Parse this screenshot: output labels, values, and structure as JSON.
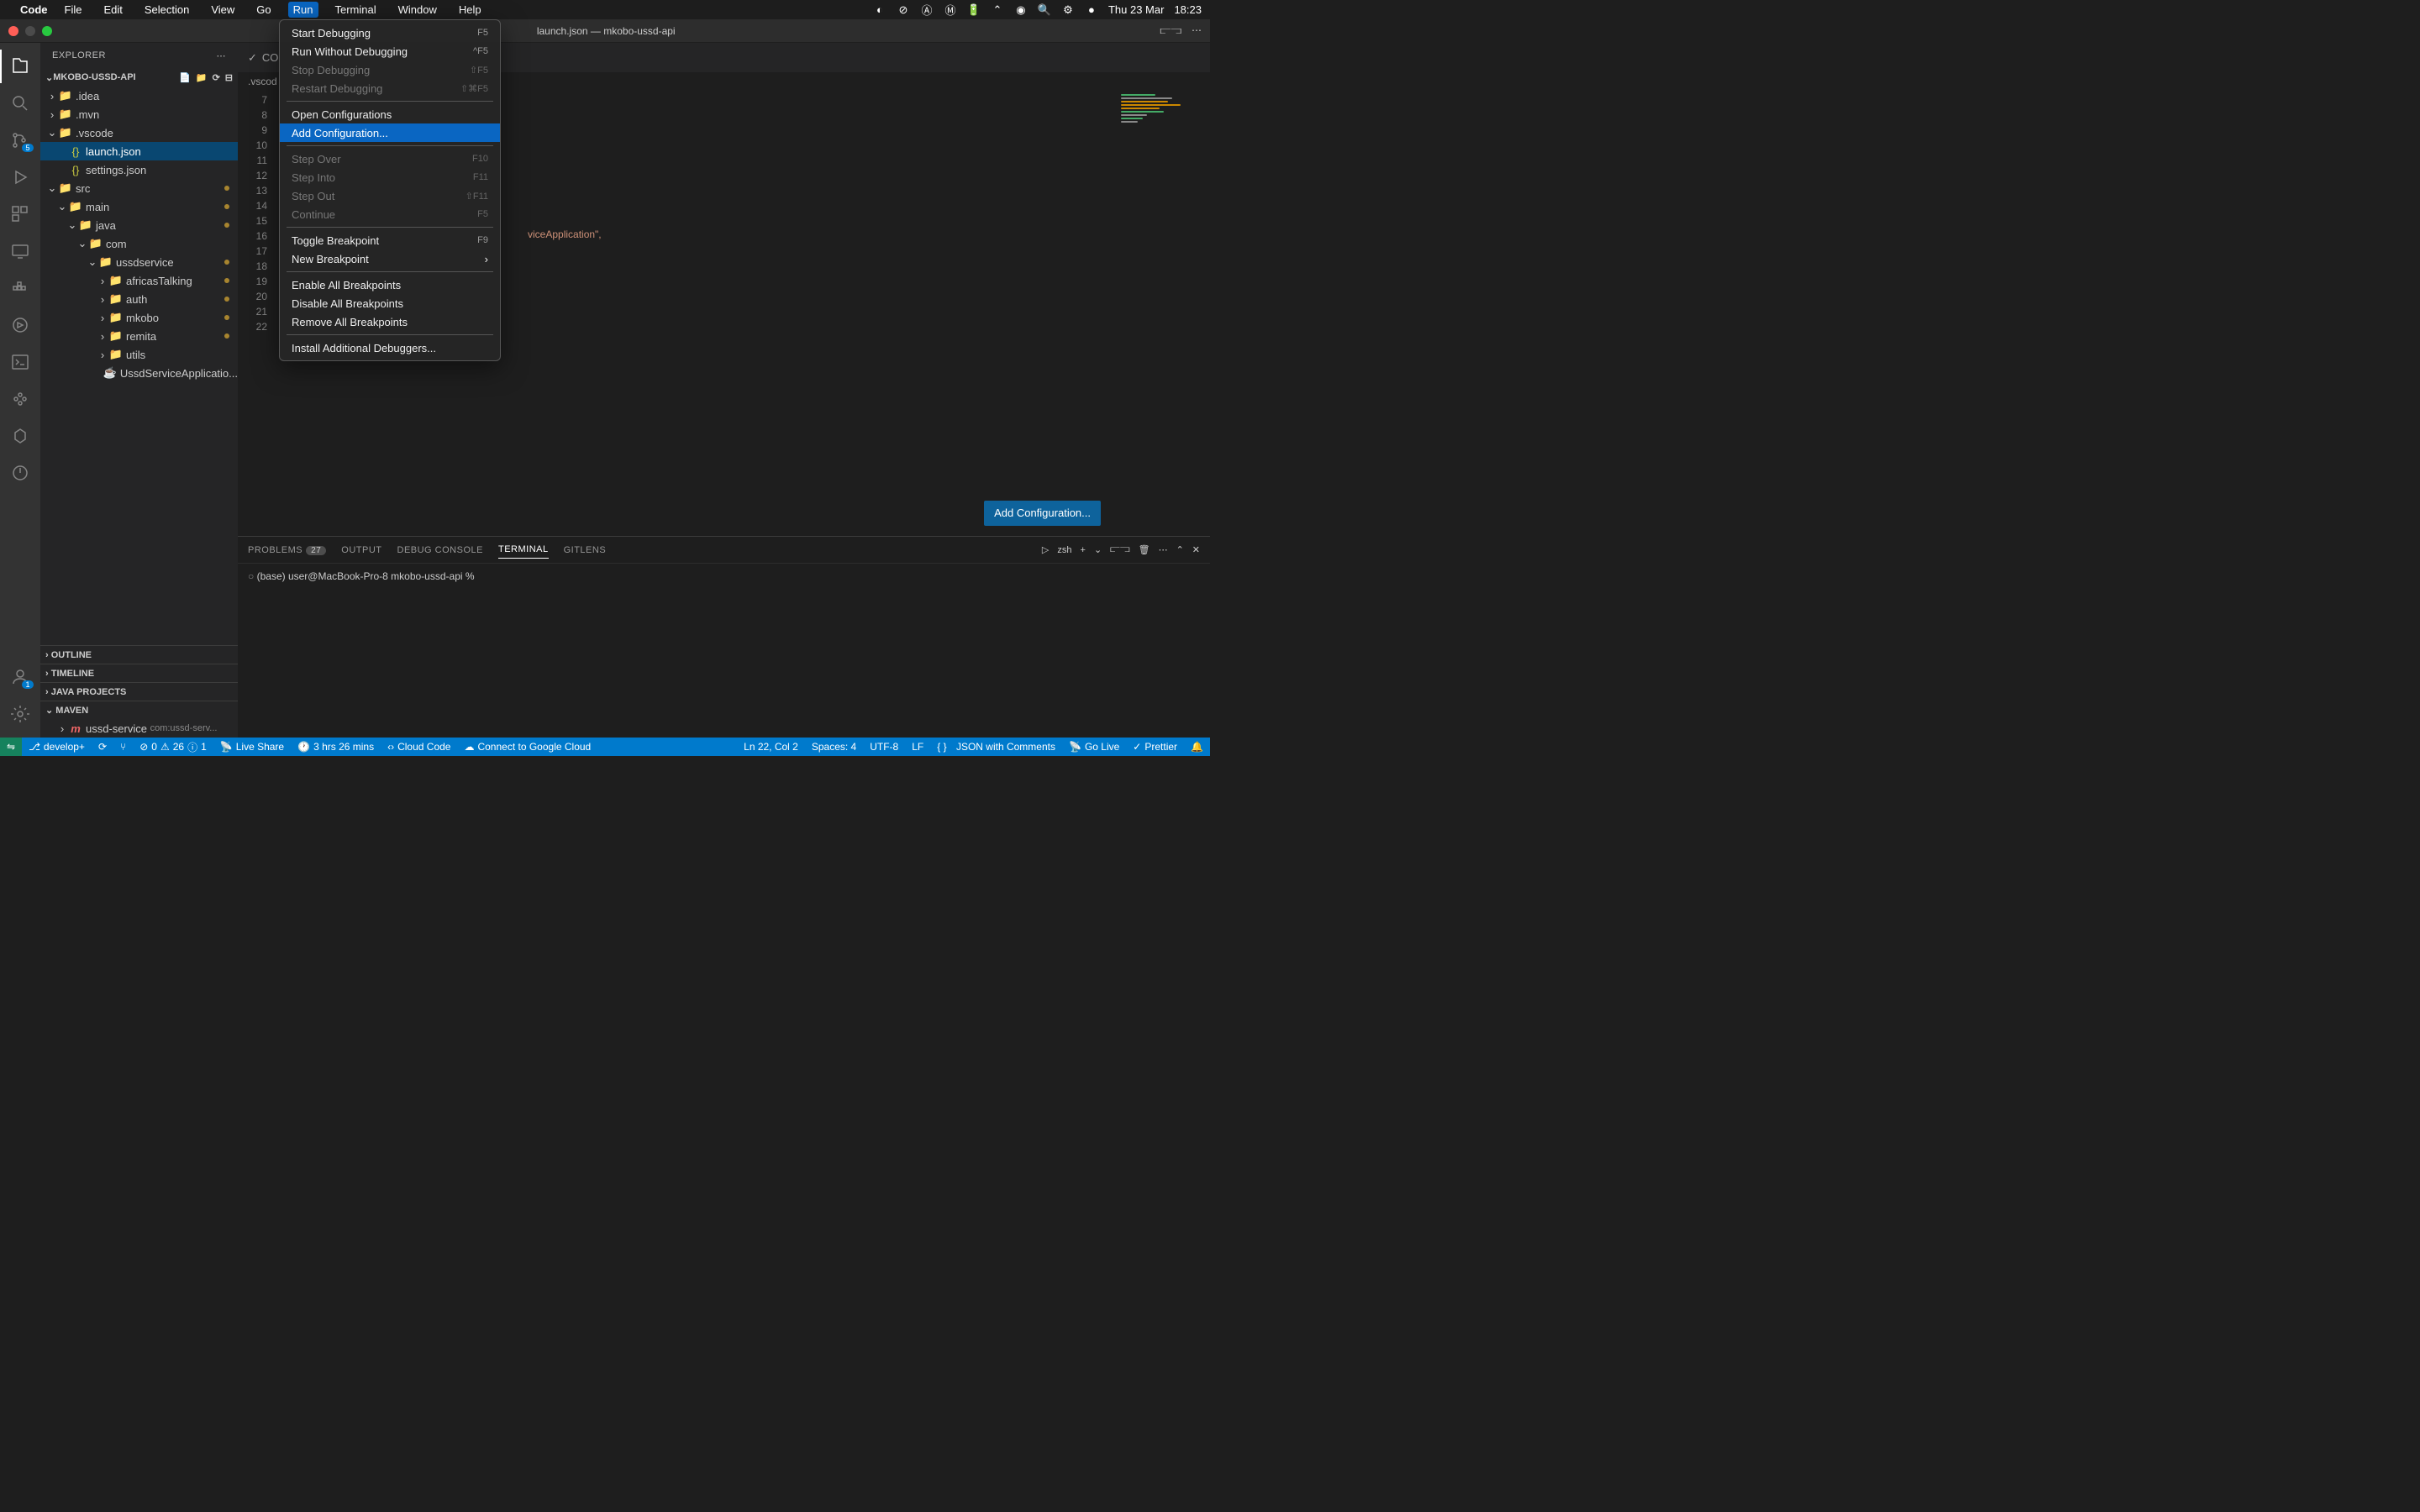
{
  "menubar": {
    "app": "Code",
    "items": [
      "File",
      "Edit",
      "Selection",
      "View",
      "Go",
      "Run",
      "Terminal",
      "Window",
      "Help"
    ],
    "active_index": 5,
    "date": "Thu 23 Mar",
    "time": "18:23"
  },
  "titlebar": {
    "title": "launch.json — mkobo-ussd-api"
  },
  "dropdown": {
    "items": [
      {
        "label": "Start Debugging",
        "shortcut": "F5",
        "disabled": false
      },
      {
        "label": "Run Without Debugging",
        "shortcut": "^F5",
        "disabled": false
      },
      {
        "label": "Stop Debugging",
        "shortcut": "⇧F5",
        "disabled": true
      },
      {
        "label": "Restart Debugging",
        "shortcut": "⇧⌘F5",
        "disabled": true
      },
      {
        "sep": true
      },
      {
        "label": "Open Configurations",
        "disabled": false
      },
      {
        "label": "Add Configuration...",
        "disabled": false,
        "highlighted": true
      },
      {
        "sep": true
      },
      {
        "label": "Step Over",
        "shortcut": "F10",
        "disabled": true
      },
      {
        "label": "Step Into",
        "shortcut": "F11",
        "disabled": true
      },
      {
        "label": "Step Out",
        "shortcut": "⇧F11",
        "disabled": true
      },
      {
        "label": "Continue",
        "shortcut": "F5",
        "disabled": true
      },
      {
        "sep": true
      },
      {
        "label": "Toggle Breakpoint",
        "shortcut": "F9",
        "disabled": false
      },
      {
        "label": "New Breakpoint",
        "submenu": true,
        "disabled": false
      },
      {
        "sep": true
      },
      {
        "label": "Enable All Breakpoints",
        "disabled": false
      },
      {
        "label": "Disable All Breakpoints",
        "disabled": false
      },
      {
        "label": "Remove All Breakpoints",
        "disabled": false
      },
      {
        "sep": true
      },
      {
        "label": "Install Additional Debuggers...",
        "disabled": false
      }
    ]
  },
  "activitybar": {
    "scm_badge": "5",
    "accounts_badge": "1"
  },
  "sidebar": {
    "title": "EXPLORER",
    "project": "MKOBO-USSD-API",
    "tree": [
      {
        "depth": 0,
        "chev": "›",
        "kind": "folder",
        "label": ".idea"
      },
      {
        "depth": 0,
        "chev": "›",
        "kind": "folder",
        "label": ".mvn"
      },
      {
        "depth": 0,
        "chev": "⌄",
        "kind": "folder",
        "label": ".vscode"
      },
      {
        "depth": 1,
        "chev": "",
        "kind": "json",
        "label": "launch.json",
        "selected": true
      },
      {
        "depth": 1,
        "chev": "",
        "kind": "json",
        "label": "settings.json"
      },
      {
        "depth": 0,
        "chev": "⌄",
        "kind": "folder",
        "label": "src",
        "mod": true
      },
      {
        "depth": 1,
        "chev": "⌄",
        "kind": "folder",
        "label": "main",
        "mod": true
      },
      {
        "depth": 2,
        "chev": "⌄",
        "kind": "folder",
        "label": "java",
        "mod": true
      },
      {
        "depth": 3,
        "chev": "⌄",
        "kind": "folder",
        "label": "com"
      },
      {
        "depth": 4,
        "chev": "⌄",
        "kind": "folder",
        "label": "ussdservice",
        "mod": true
      },
      {
        "depth": 5,
        "chev": "›",
        "kind": "folder",
        "label": "africasTalking",
        "mod": true
      },
      {
        "depth": 5,
        "chev": "›",
        "kind": "folder",
        "label": "auth",
        "mod": true
      },
      {
        "depth": 5,
        "chev": "›",
        "kind": "folder",
        "label": "mkobo",
        "mod": true
      },
      {
        "depth": 5,
        "chev": "›",
        "kind": "folder",
        "label": "remita",
        "mod": true
      },
      {
        "depth": 5,
        "chev": "›",
        "kind": "folder",
        "label": "utils"
      },
      {
        "depth": 5,
        "chev": "",
        "kind": "java",
        "label": "UssdServiceApplicatio..."
      }
    ],
    "sections": [
      "OUTLINE",
      "TIMELINE",
      "JAVA PROJECTS",
      "MAVEN"
    ],
    "maven_item": {
      "name": "ussd-service",
      "desc": "com:ussd-serv..."
    }
  },
  "editor": {
    "breadcrumb": ".vscod",
    "line_start": 7,
    "line_end": 22,
    "visible_code_fragment": "viceApplication\",",
    "add_config_button": "Add Configuration..."
  },
  "panel": {
    "tabs": [
      {
        "label": "PROBLEMS",
        "count": "27"
      },
      {
        "label": "OUTPUT"
      },
      {
        "label": "DEBUG CONSOLE"
      },
      {
        "label": "TERMINAL",
        "active": true
      },
      {
        "label": "GITLENS"
      }
    ],
    "shell": "zsh",
    "prompt": "(base) user@MacBook-Pro-8 mkobo-ussd-api %"
  },
  "statusbar": {
    "branch": "develop+",
    "errors": "0",
    "warnings": "26",
    "info": "1",
    "live_share": "Live Share",
    "duration": "3 hrs 26 mins",
    "cloud_code": "Cloud Code",
    "connect_gcp": "Connect to Google Cloud",
    "cursor": "Ln 22, Col 2",
    "spaces": "Spaces: 4",
    "encoding": "UTF-8",
    "eol": "LF",
    "lang": "JSON with Comments",
    "go_live": "Go Live",
    "prettier": "Prettier"
  }
}
